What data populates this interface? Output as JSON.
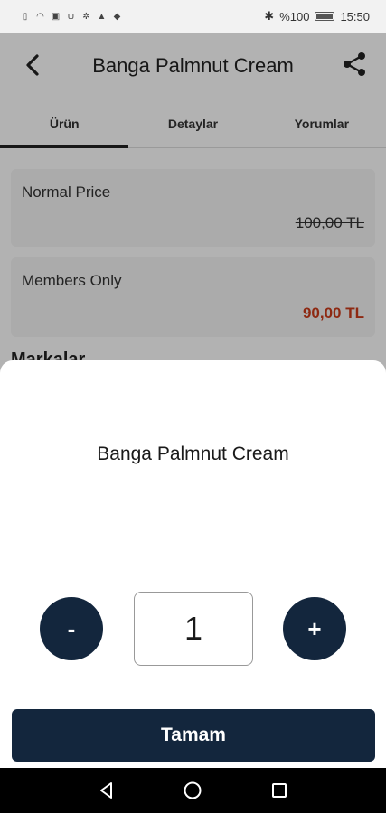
{
  "status_bar": {
    "battery": "%100",
    "time": "15:50"
  },
  "header": {
    "title": "Banga Palmnut Cream"
  },
  "tabs": [
    {
      "label": "Ürün",
      "active": true
    },
    {
      "label": "Detaylar",
      "active": false
    },
    {
      "label": "Yorumlar",
      "active": false
    }
  ],
  "prices": {
    "normal_label": "Normal Price",
    "normal_value": "100,00 TL",
    "members_label": "Members Only",
    "members_value": "90,00 TL"
  },
  "section": {
    "peek_title": "Markalar"
  },
  "sheet": {
    "title": "Banga Palmnut Cream",
    "minus_label": "-",
    "quantity": "1",
    "plus_label": "+",
    "confirm_label": "Tamam"
  },
  "colors": {
    "primary": "#13263d",
    "member_price": "#cc3b1a"
  },
  "icons": {
    "back": "arrow-left",
    "share": "share",
    "nav_back": "triangle-back",
    "nav_home": "circle-home",
    "nav_recent": "square-recent"
  }
}
